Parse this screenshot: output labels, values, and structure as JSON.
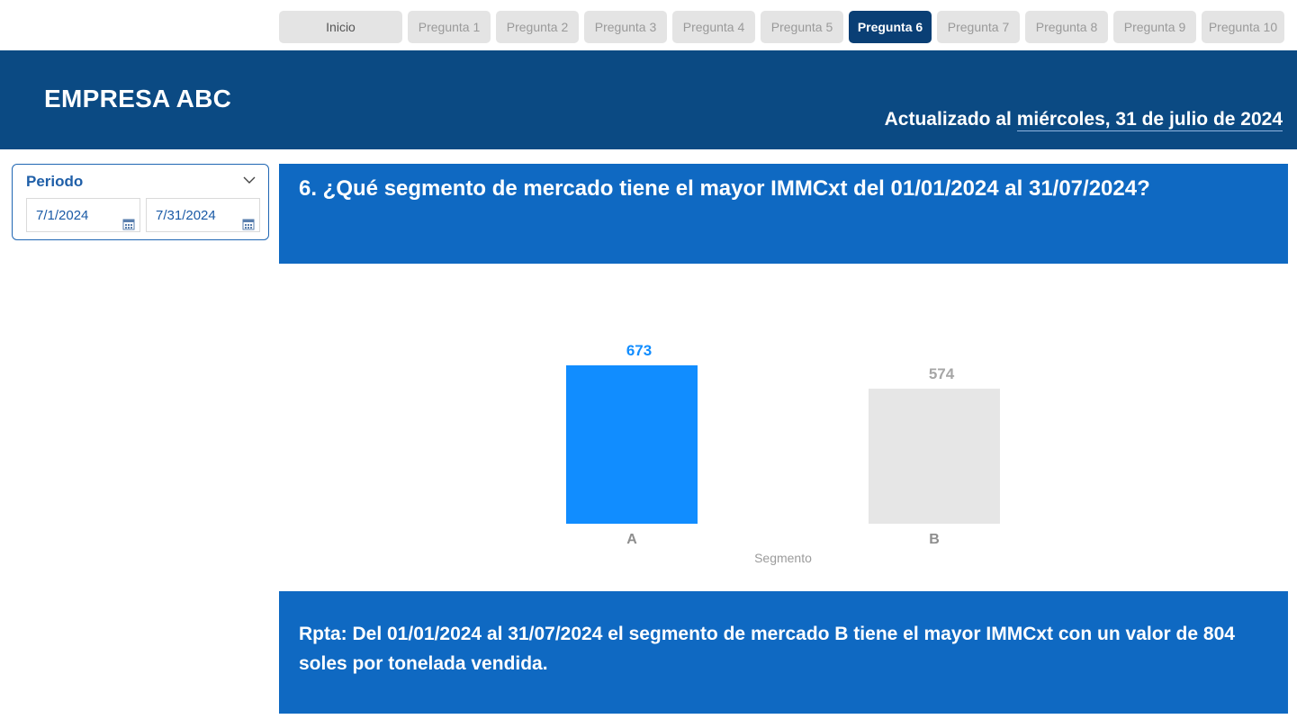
{
  "nav": {
    "home": "Inicio",
    "questions": [
      "Pregunta 1",
      "Pregunta 2",
      "Pregunta 3",
      "Pregunta 4",
      "Pregunta 5",
      "Pregunta 6",
      "Pregunta 7",
      "Pregunta 8",
      "Pregunta 9",
      "Pregunta 10"
    ],
    "active_index": 5
  },
  "header": {
    "company": "EMPRESA ABC",
    "updated_prefix": "Actualizado al",
    "updated_date": "miércoles, 31 de julio de 2024"
  },
  "filter": {
    "label": "Periodo",
    "start": "7/1/2024",
    "end": "7/31/2024",
    "icons": {
      "dropdown": "chevron-down-icon",
      "calendar": "calendar-icon"
    }
  },
  "question": {
    "text": "6. ¿Qué segmento de mercado tiene el mayor IMMCxt del 01/01/2024 al 31/07/2024?"
  },
  "chart_data": {
    "type": "bar",
    "categories": [
      "A",
      "B"
    ],
    "values": [
      673,
      574
    ],
    "data_labels": [
      "673",
      "574"
    ],
    "colors": [
      "#118dff",
      "#e6e6e6"
    ],
    "label_colors": [
      "#118dff",
      "#a6a6a6"
    ],
    "xlabel": "Segmento",
    "ylabel": "",
    "ylim": [
      0,
      700
    ],
    "grid": false,
    "legend": "none"
  },
  "answer": {
    "text": "Rpta: Del 01/01/2024 al 31/07/2024 el segmento de mercado B tiene el mayor IMMCxt con un valor de 804 soles por tonelada vendida."
  },
  "colors": {
    "header_bg": "#0b4a83",
    "panel_bg": "#0f69c2",
    "nav_active": "#0a3f75",
    "nav_inactive": "#e4e4e4",
    "accent": "#118dff"
  }
}
